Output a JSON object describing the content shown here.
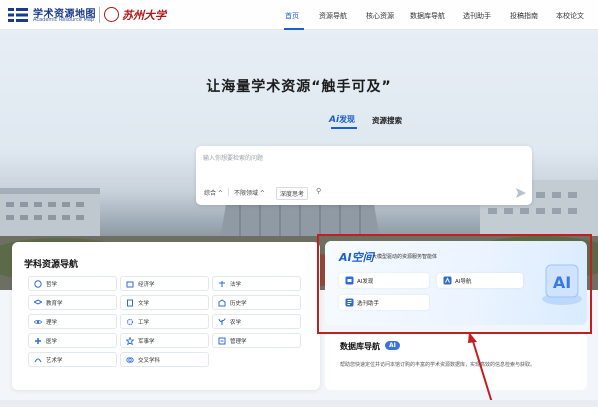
{
  "header": {
    "logo_title": "学术资源地图",
    "logo_sub": "Academic Resource Map",
    "university": "苏州大学",
    "nav": [
      "首页",
      "资源导航",
      "核心资源",
      "数据库导航",
      "选刊助手",
      "投稿指南",
      "本校论文"
    ]
  },
  "hero": {
    "slogan": "让海量学术资源“触手可及”",
    "tab_ai_prefix": "Ai",
    "tab_ai_suffix": "发现",
    "tab_search": "资源搜索"
  },
  "search": {
    "placeholder": "输入你想要检索的问题",
    "chip_all": "综合 ^",
    "chip_field": "不限领域 ^",
    "deep_think": "深度思考"
  },
  "subjects": {
    "title": "学科资源导航",
    "items": [
      "哲学",
      "经济学",
      "法学",
      "教育学",
      "文学",
      "历史学",
      "理学",
      "工学",
      "农学",
      "医学",
      "军事学",
      "管理学",
      "艺术学",
      "交叉学科"
    ]
  },
  "ai_space": {
    "logo": "AI空间",
    "desc": "大模型驱动的资源服务智能体",
    "buttons": [
      "AI发现",
      "AI导航",
      "选刊助手"
    ]
  },
  "database": {
    "title": "数据库导航",
    "badge": "AI",
    "desc": "帮助您快速定位并访问本馆订购的丰富的学术资源数据库，实现高效的信息检索与获取。"
  },
  "colors": {
    "accent": "#1a5fd0",
    "highlight": "#c22020"
  }
}
